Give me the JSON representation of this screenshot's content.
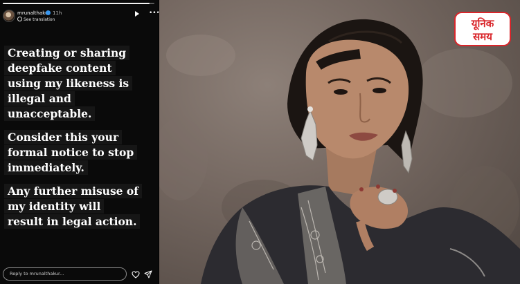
{
  "story": {
    "progress": 0.97,
    "username": "mrunalthakur",
    "verified": true,
    "time": "11h",
    "see_translation": "See translation",
    "message": [
      [
        "Creating or sharing",
        "deepfake content",
        "using my likeness is",
        "illegal and",
        "unacceptable."
      ],
      [
        "Consider this your",
        "formal notice to stop",
        "immediately."
      ],
      [
        "Any further misuse of",
        "my identity will",
        "result in legal action."
      ]
    ],
    "reply_placeholder": "Reply to mrunalthakur...",
    "icons": {
      "play": "play-icon",
      "more": "more-icon",
      "like": "heart-icon",
      "share": "send-icon"
    }
  },
  "watermark": {
    "text": "यूनिक समय",
    "colors": {
      "border": "#d9262b",
      "text": "#d9262b"
    }
  },
  "photo": {
    "alt": "woman in dark embroidered outfit with long earrings against textured wall"
  }
}
